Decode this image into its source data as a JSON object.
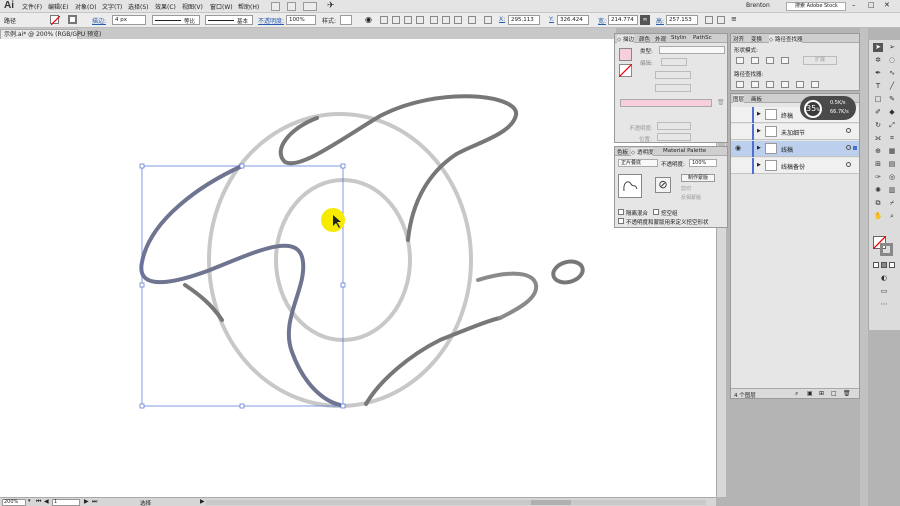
{
  "app": {
    "logo": "Ai",
    "user": "Brenton",
    "search_placeholder": "搜索 Adobe Stock"
  },
  "menu": [
    "文件(F)",
    "编辑(E)",
    "对象(O)",
    "文字(T)",
    "选择(S)",
    "效果(C)",
    "视图(V)",
    "窗口(W)",
    "帮助(H)"
  ],
  "control": {
    "selection": "路径",
    "stroke_label": "描边:",
    "stroke_value": "4 px",
    "profile_label": "等比",
    "brush_label": "基本",
    "opacity_label": "不透明度:",
    "opacity_value": "100%",
    "style_label": "样式:",
    "x_label": "X:",
    "x_value": "295.113",
    "y_label": "Y:",
    "y_value": "326.424",
    "w_label": "宽:",
    "w_value": "214.774",
    "h_label": "高:",
    "h_value": "257.153"
  },
  "document": {
    "tab_title": "示例.ai* @ 200% (RGB/GPU 预览)"
  },
  "status": {
    "zoom": "200%",
    "page": "1",
    "tool": "选择"
  },
  "panel_appearance": {
    "tabs": [
      "◇ 描边",
      "颜色",
      "外观",
      "Stylin",
      "PathSc"
    ],
    "type_label": "类型:",
    "edit_label": "编辑:",
    "opacity_label": "不透明度:",
    "position_label": "位置:"
  },
  "panel_transparency": {
    "tabs": [
      "色板",
      "◇ 透明度",
      "Material Palette"
    ],
    "blend_mode": "正片叠底",
    "opacity_label": "不透明度:",
    "opacity_value": "100%",
    "make_mask": "制作蒙版",
    "clip": "剪切",
    "invert_mask": "反相蒙版",
    "isolate_blending": "隔离混合",
    "knockout_group": "挖空组",
    "opacity_mask_define": "不透明度和蒙版用来定义挖空形状"
  },
  "panel_pathfinder": {
    "tabs": [
      "对齐",
      "变换",
      "◇ 路径查找器"
    ],
    "shape_modes": "形状模式:",
    "expand": "扩展",
    "pathfinders": "路径查找器:"
  },
  "panel_layers": {
    "tabs": [
      "图层",
      "画板"
    ],
    "layers": [
      {
        "name": "终稿",
        "selected": false
      },
      {
        "name": "未加细节",
        "selected": false
      },
      {
        "name": "线稿",
        "selected": true
      },
      {
        "name": "线稿备份",
        "selected": false
      }
    ],
    "count": "4 个图层"
  },
  "zoom_badge": {
    "percent": "35",
    "unit": "%",
    "up": "0.5K/s",
    "down": "66.7K/s"
  },
  "colors": {
    "accent_blue": "#4f6fd0",
    "selection_blue": "#bcd0ee",
    "cursor_yellow": "#f5ea00",
    "fill_pink": "#f7cfdc"
  }
}
